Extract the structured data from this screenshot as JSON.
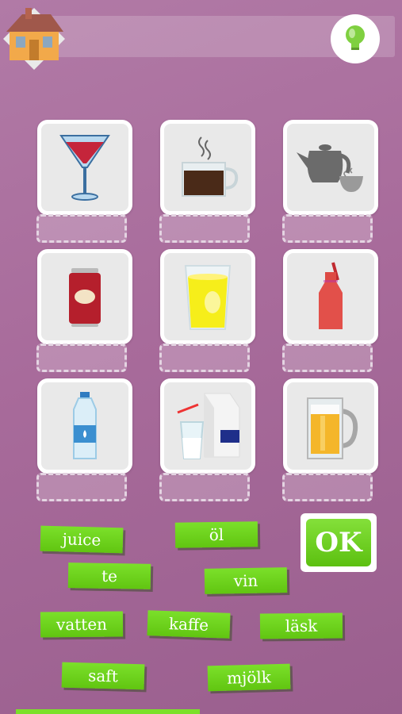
{
  "header": {
    "home_icon": "house-icon",
    "hint_icon": "lightbulb-icon"
  },
  "cards": [
    {
      "icon": "wine-glass-icon"
    },
    {
      "icon": "coffee-cup-icon"
    },
    {
      "icon": "teapot-icon"
    },
    {
      "icon": "soda-can-icon"
    },
    {
      "icon": "juice-glass-icon"
    },
    {
      "icon": "soda-bottle-icon"
    },
    {
      "icon": "water-bottle-icon"
    },
    {
      "icon": "milk-carton-icon"
    },
    {
      "icon": "beer-mug-icon"
    }
  ],
  "words": {
    "juice": "juice",
    "ol": "öl",
    "te": "te",
    "vin": "vin",
    "vatten": "vatten",
    "kaffe": "kaffe",
    "lask": "läsk",
    "saft": "saft",
    "mjolk": "mjölk"
  },
  "ok_label": "OK",
  "colors": {
    "accent": "#6fd21c",
    "background": "#a86b9b"
  }
}
